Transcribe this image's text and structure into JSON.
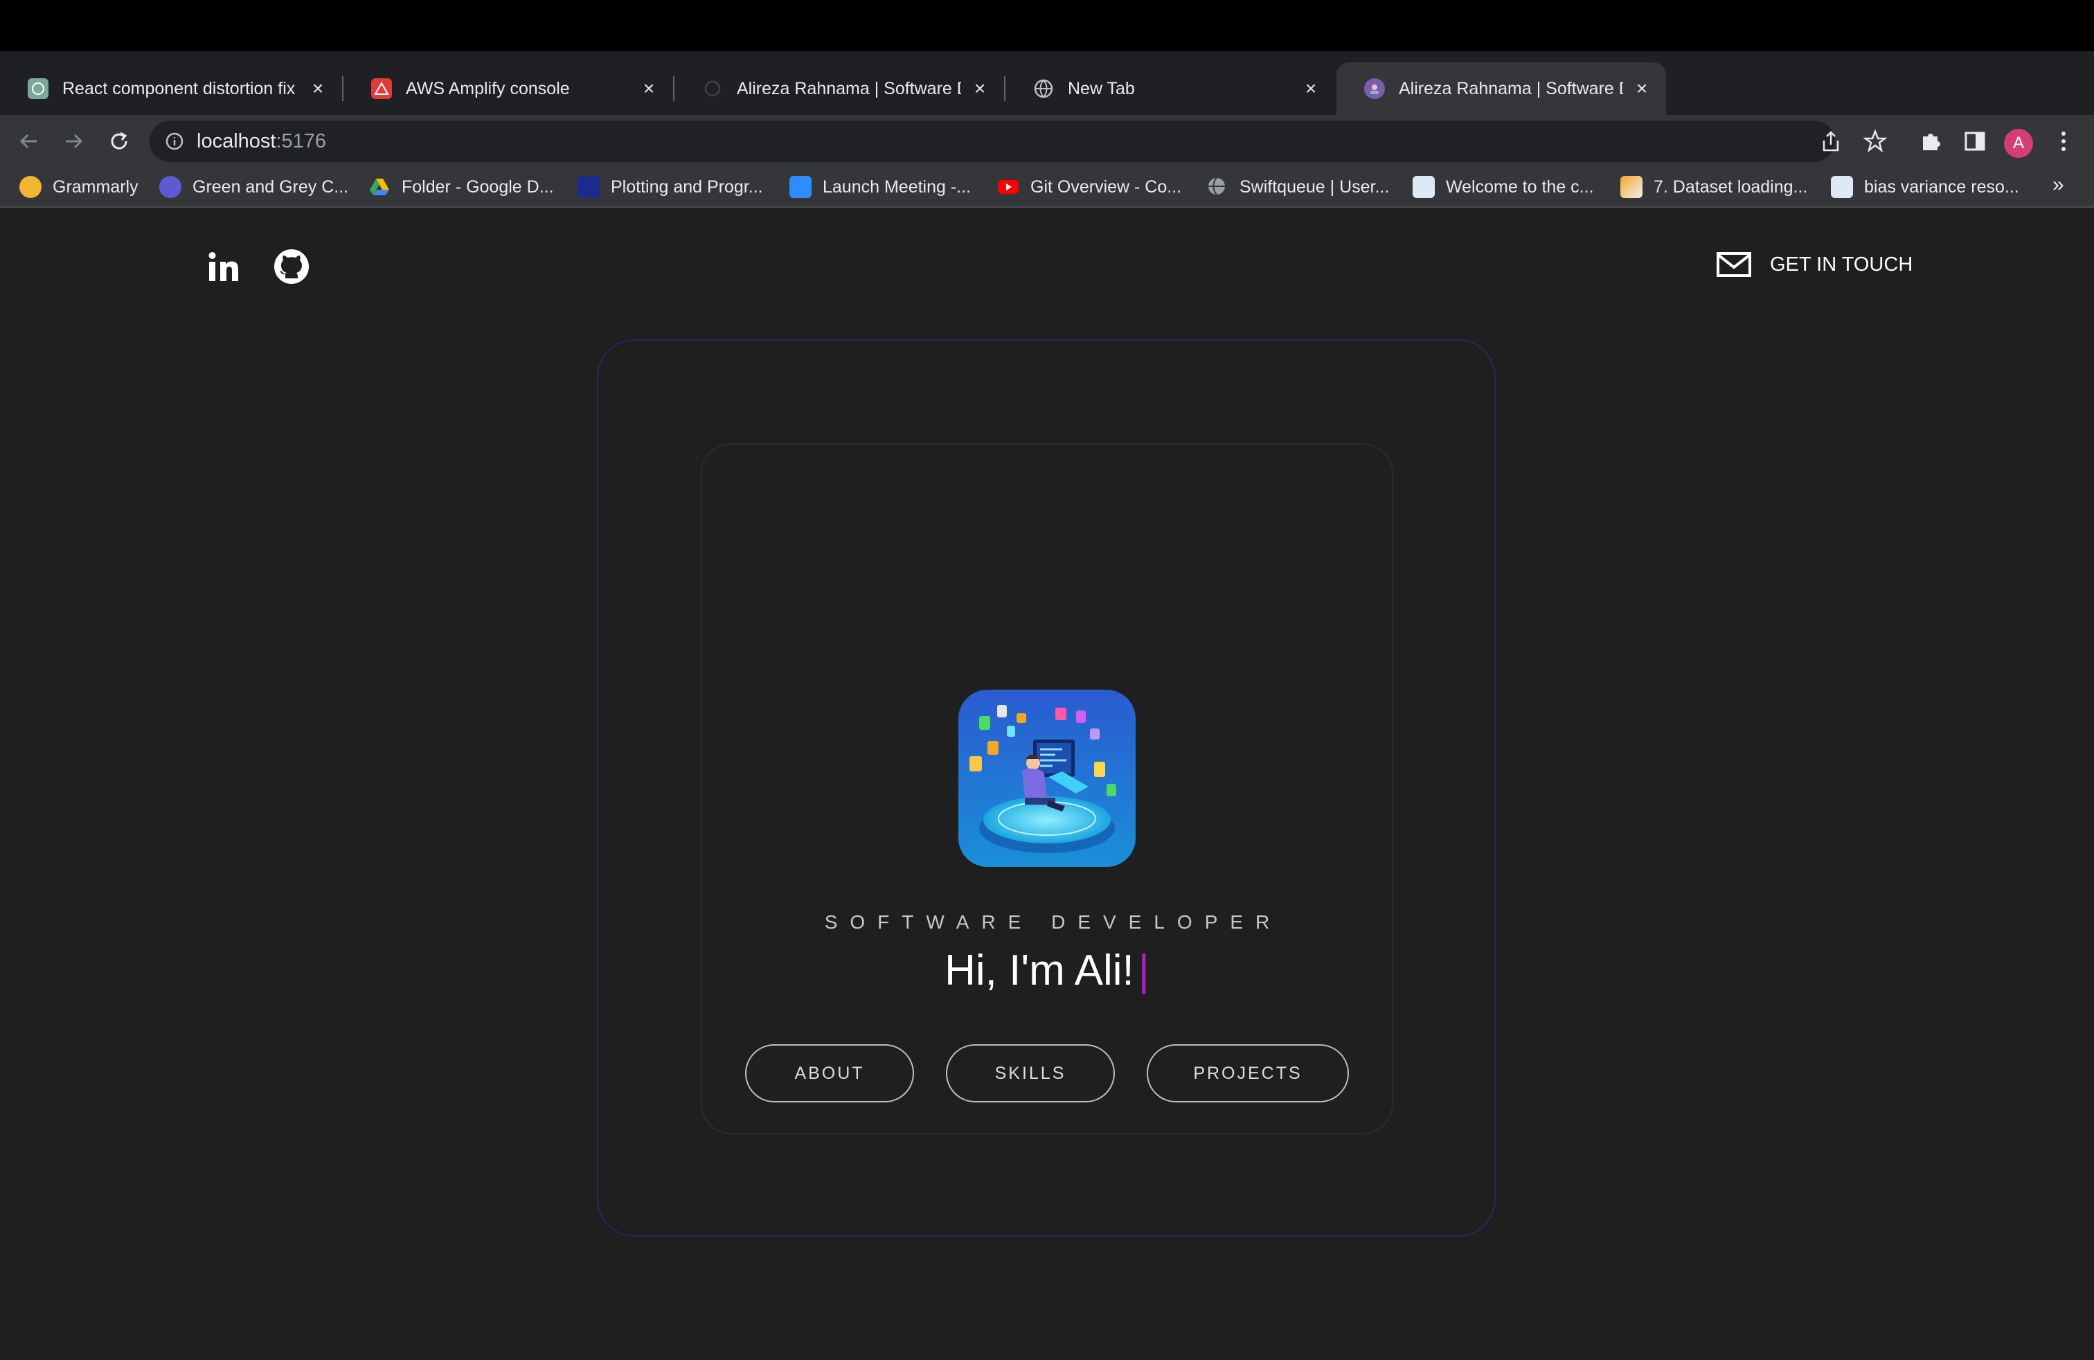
{
  "browser": {
    "tabs": [
      {
        "title": "React component distortion fix",
        "active": false
      },
      {
        "title": "AWS Amplify console",
        "active": false
      },
      {
        "title": "Alireza Rahnama | Software De",
        "active": false
      },
      {
        "title": "New Tab",
        "active": false
      },
      {
        "title": "Alireza Rahnama | Software De",
        "active": true
      }
    ],
    "new_tab_glyph": "+",
    "close_glyph": "×",
    "address": {
      "host": "localhost",
      "port": ":5176"
    },
    "avatar_letter": "A",
    "bookmarks": [
      "Grammarly",
      "Green and Grey C...",
      "Folder - Google D...",
      "Plotting and Progr...",
      "Launch Meeting -...",
      "Git Overview - Co...",
      "Swiftqueue | User...",
      "Welcome to the c...",
      "7. Dataset loading...",
      "bias variance reso..."
    ],
    "bookmarks_more": "»"
  },
  "page": {
    "cta_label": "GET IN TOUCH",
    "role": "SOFTWARE DEVELOPER",
    "greeting": "Hi, I'm Ali!",
    "cursor": "|",
    "buttons": {
      "about": "ABOUT",
      "skills": "SKILLS",
      "projects": "PROJECTS"
    }
  },
  "colors": {
    "page_bg": "#1f1f1f",
    "outer_border": "#2f2560",
    "cursor": "#b020c0",
    "avatar": "#d33e74"
  }
}
